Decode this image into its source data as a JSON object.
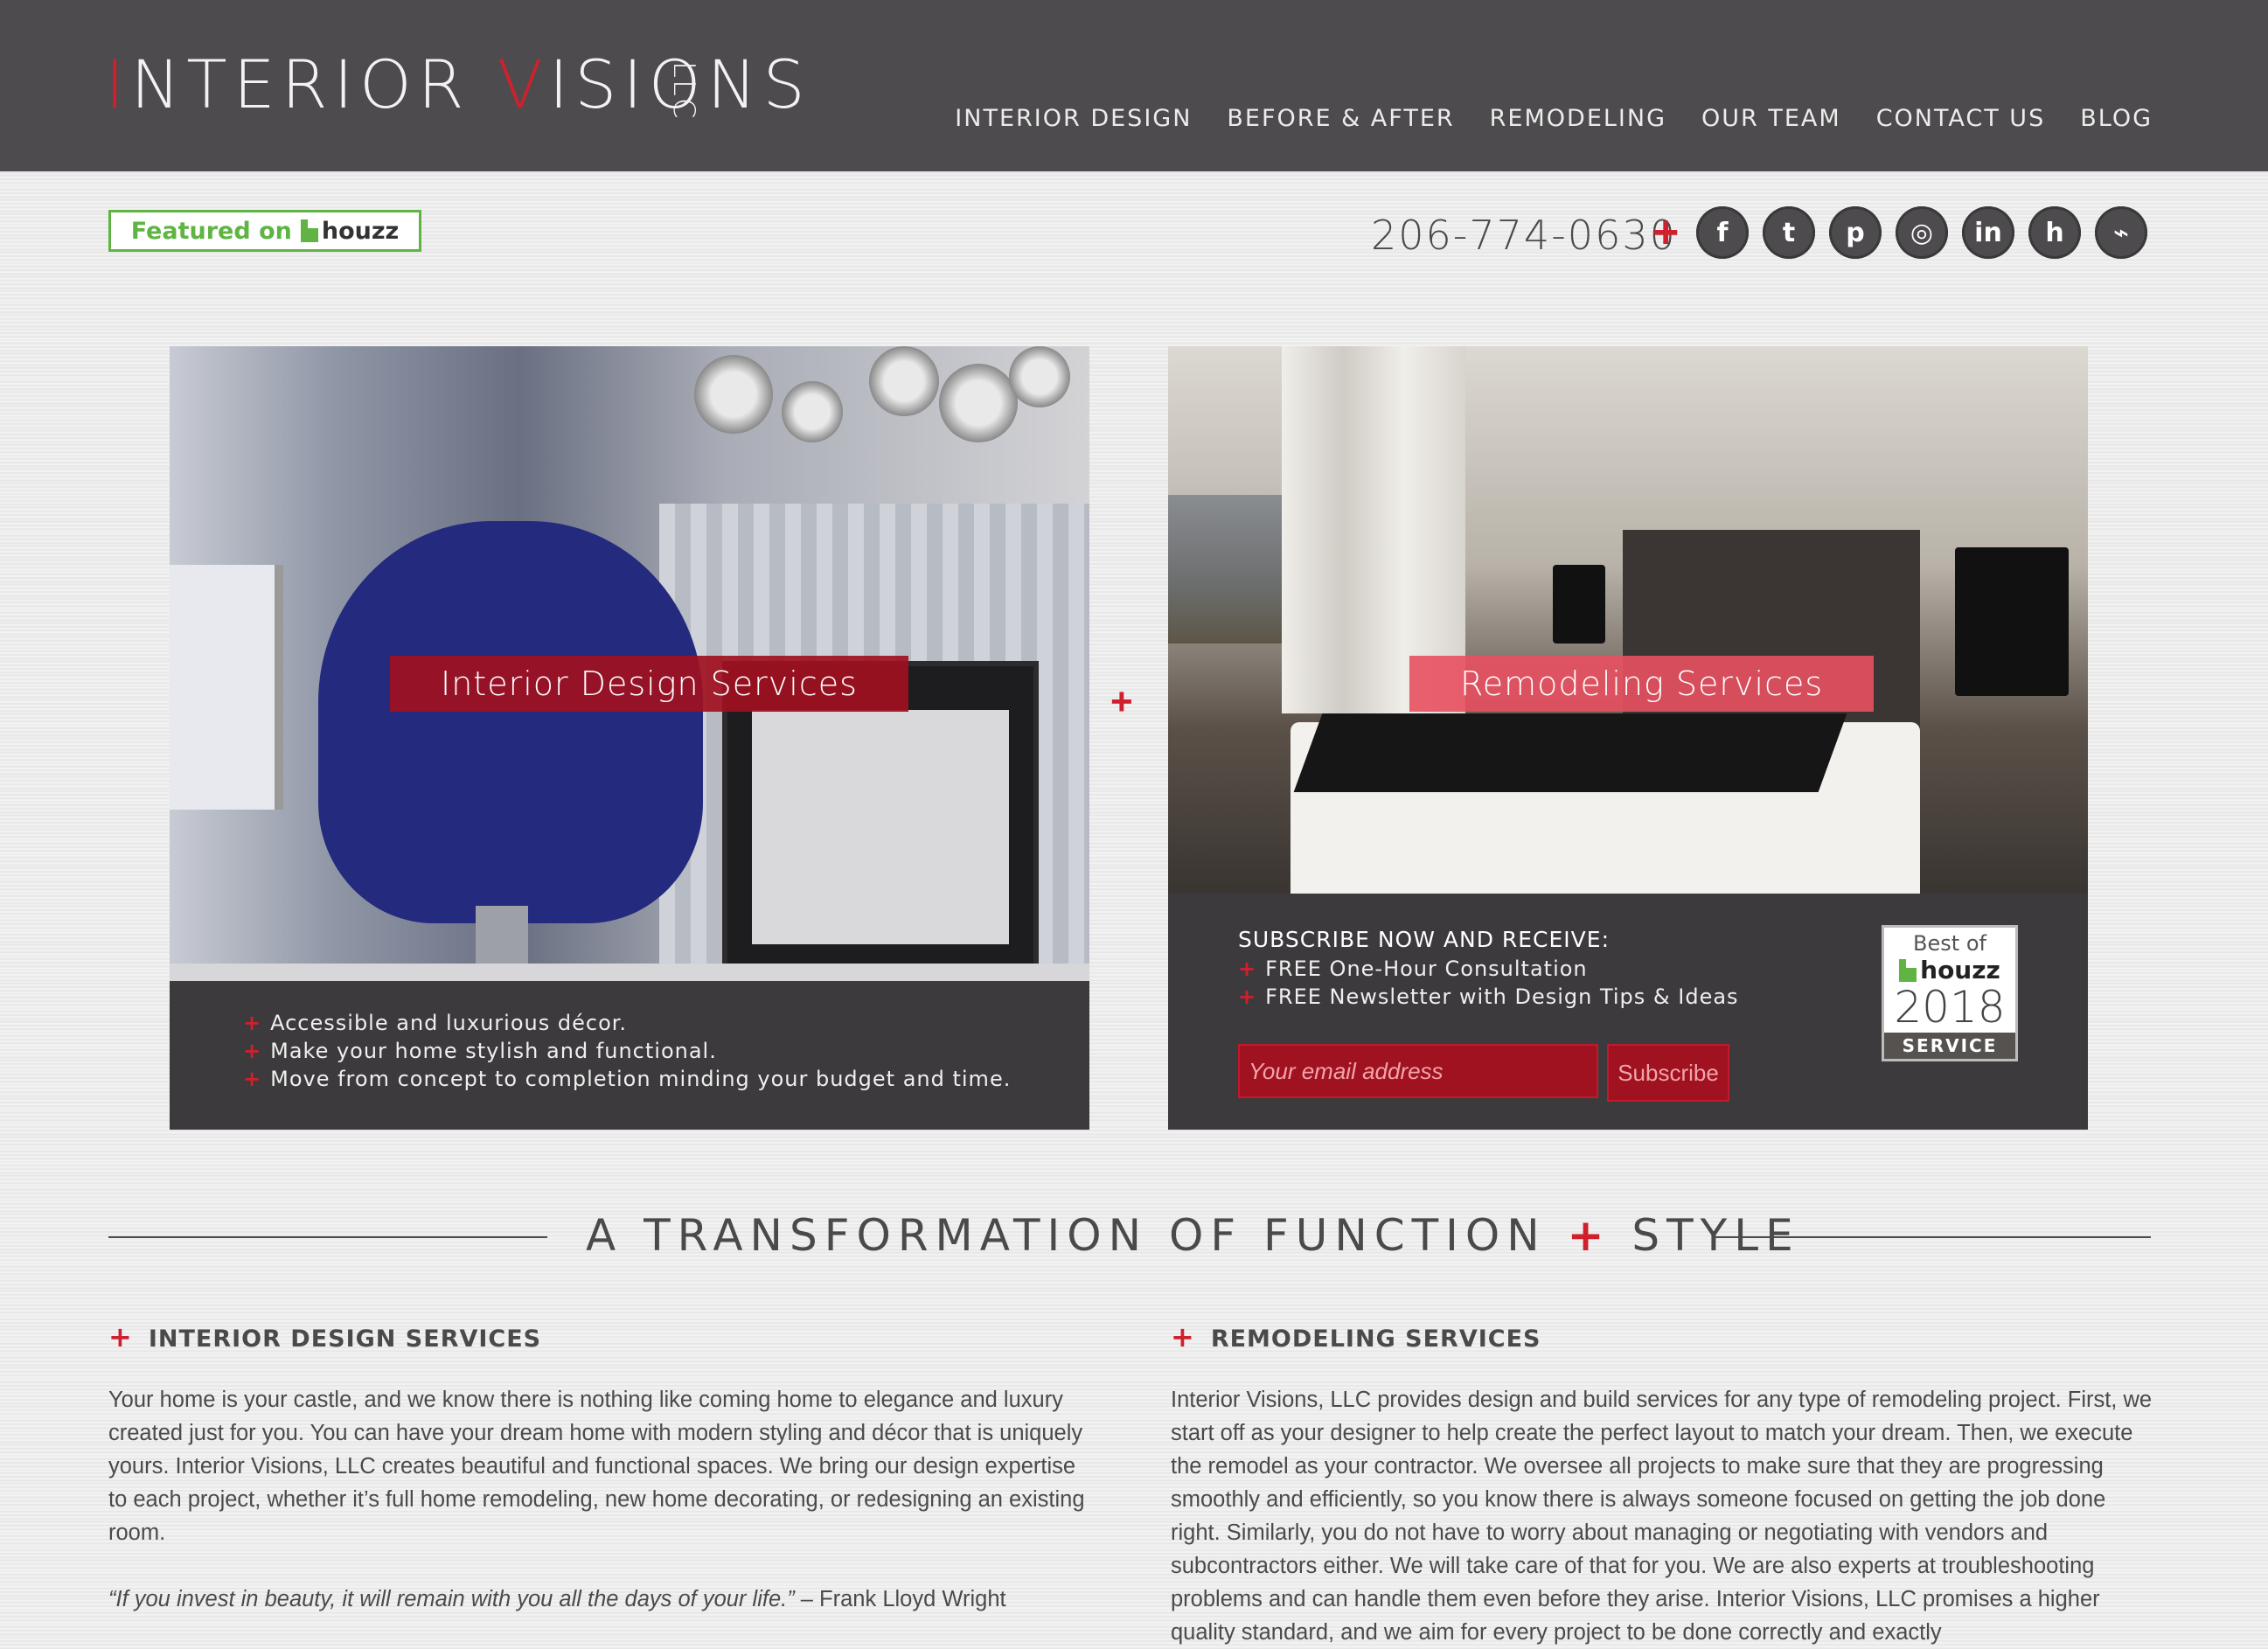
{
  "header": {
    "logo": {
      "first_initial": "I",
      "first_rest": "NTERIOR ",
      "second_initial": "V",
      "second_rest": "ISIONS",
      "suffix": "LLC"
    },
    "nav": [
      "INTERIOR DESIGN",
      "BEFORE & AFTER",
      "REMODELING",
      "OUR TEAM",
      "CONTACT US",
      "BLOG"
    ]
  },
  "featured_badge": {
    "featured": "Featured on",
    "brand": "houzz"
  },
  "contact": {
    "phone": "206-774-0630",
    "plus": "+",
    "social": [
      {
        "icon": "facebook-icon",
        "glyph": "f"
      },
      {
        "icon": "twitter-icon",
        "glyph": "t"
      },
      {
        "icon": "pinterest-icon",
        "glyph": "p"
      },
      {
        "icon": "instagram-icon",
        "glyph": "◎"
      },
      {
        "icon": "linkedin-icon",
        "glyph": "in"
      },
      {
        "icon": "houzz-icon",
        "glyph": "h"
      },
      {
        "icon": "rss-icon",
        "glyph": "⌁"
      }
    ]
  },
  "cards": {
    "left": {
      "label": "Interior Design Services",
      "bullets": [
        "Accessible and luxurious décor.",
        "Make your home stylish and functional.",
        "Move from concept to completion minding your budget and time."
      ]
    },
    "between_plus": "+",
    "right": {
      "label": "Remodeling Services",
      "subscribe_title": "SUBSCRIBE NOW AND RECEIVE:",
      "subscribe_items": [
        "FREE One-Hour Consultation",
        "FREE Newsletter with Design Tips & Ideas"
      ],
      "email_placeholder": "Your email address",
      "subscribe_button": "Subscribe",
      "badge": {
        "best_of": "Best of",
        "brand": "houzz",
        "year": "2018",
        "category": "SERVICE"
      }
    }
  },
  "tagline": {
    "part1": "A TRANSFORMATION OF FUNCTION",
    "plus": "+",
    "part2": "STYLE"
  },
  "sections": {
    "left": {
      "title": "INTERIOR DESIGN SERVICES",
      "body": "Your home is your castle, and we know there is nothing like coming home to elegance and luxury created just for you. You can have your dream home with modern styling and décor that is uniquely yours. Interior Visions, LLC creates beautiful and functional spaces. We bring our design expertise to each project, whether it’s full home remodeling, new home decorating, or redesigning an existing room.",
      "quote": "“If you invest in beauty, it will remain with you all the days of your life.”",
      "quote_author": " – Frank Lloyd Wright"
    },
    "right": {
      "title": "REMODELING SERVICES",
      "body": "Interior Visions, LLC provides design and build services for any type of remodeling project. First, we start off as your designer to help create the perfect layout to match your dream. Then, we execute the remodel as your contractor. We oversee all projects to make sure that they are progressing smoothly and efficiently, so you know there is always someone focused on getting the job done right. Similarly, you do not have to worry about managing or negotiating with vendors and subcontractors either. We will take care of that for you. We are also experts at troubleshooting problems and can handle them even before they arise. Interior Visions, LLC promises a higher quality standard, and we aim for every project to be done correctly and exactly"
    }
  },
  "colors": {
    "accent": "#d0202e",
    "header_bg": "#4d4b4d",
    "houzz_green": "#5fb443"
  }
}
